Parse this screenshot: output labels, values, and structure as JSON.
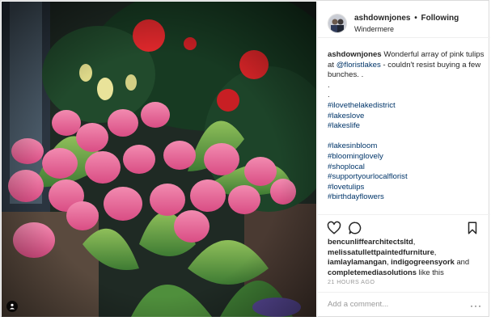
{
  "post": {
    "username": "ashdownjones",
    "separator": "•",
    "follow_label": "Following",
    "location": "Windermere",
    "caption_user": "ashdownjones",
    "caption_text_1": "Wonderful array of pink tulips at",
    "caption_mention": "@floristlakes",
    "caption_text_2": "- couldn't resist buying a few bunches. .",
    "caption_dots": [
      ".",
      "."
    ],
    "hashtags_group_1": [
      "#ilovethelakedistrict",
      "#lakeslove",
      "#lakeslife"
    ],
    "hashtags_group_2": [
      "#lakesinbloom",
      "#bloominglovely",
      "#shoplocal",
      "#supportyourlocalflorist",
      "#lovetulips",
      "#birthdayflowers"
    ],
    "likers": [
      "bencunliffearchitectsltd",
      "melissatullettpaintedfurniture",
      "iamlaylamangan",
      "indigogreensyork"
    ],
    "likes_and": "and",
    "likes_last": "completemediasolutions",
    "likes_suffix": "like this",
    "timestamp": "21 HOURS AGO",
    "comment_placeholder": "Add a comment...",
    "more_label": "···"
  },
  "icons": {
    "like": "heart-icon",
    "comment": "comment-icon",
    "save": "bookmark-icon",
    "user_tag": "user-tag-icon"
  },
  "colors": {
    "link": "#003569",
    "text": "#262626",
    "muted": "#999999",
    "border": "#efefef"
  }
}
